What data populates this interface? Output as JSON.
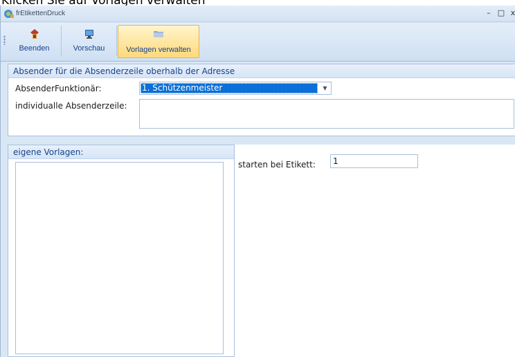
{
  "caption": "Klicken Sie auf Vorlagen verwalten",
  "window": {
    "title": "frEtikettenDruck",
    "minimize": "–",
    "maximize": "□",
    "close": "x"
  },
  "toolbar": {
    "beenden_label": "Beenden",
    "vorschau_label": "Vorschau",
    "vorlagen_label": "Vorlagen verwalten"
  },
  "absender_group": {
    "header": "Absender für die Absenderzeile oberhalb der Adresse",
    "funktionaer_label": "AbsenderFunktionär:",
    "funktionaer_value": "1. Schützenmeister",
    "individual_label": "individualle Absenderzeile:",
    "individual_value": ""
  },
  "vorlagen_group": {
    "header": "eigene Vorlagen:",
    "items": []
  },
  "start": {
    "label": "starten bei Etikett:",
    "value": "1"
  },
  "colors": {
    "accent": "#15428b",
    "selection": "#0a6fd6",
    "active_button": "#ffd97a"
  }
}
